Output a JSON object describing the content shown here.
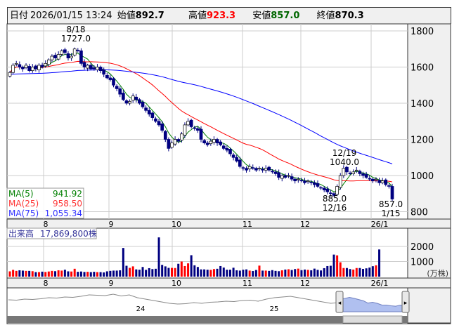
{
  "header": {
    "date_label": "日付",
    "datetime": "2026/01/15 13:24",
    "open_label": "始値",
    "open": "892.7",
    "high_label": "高値",
    "high": "923.3",
    "low_label": "安値",
    "low": "857.0",
    "close_label": "終値",
    "close": "870.3"
  },
  "colors": {
    "up": "#ff0000",
    "down": "#000080",
    "ma5": "#008000",
    "ma25": "#ff0000",
    "ma75": "#0000ff",
    "high": "#ff0000",
    "low": "#006600"
  },
  "legend": {
    "ma5_label": "MA(5)",
    "ma5": "941.92",
    "ma25_label": "MA(25)",
    "ma25": "958.50",
    "ma75_label": "MA(75)",
    "ma75": "1,055.34"
  },
  "volume_legend": {
    "label": "出来高",
    "value": "17,869,800株"
  },
  "annotations": {
    "high_date": "8/18",
    "high_value": "1727.0",
    "low_date": "12/16",
    "low_value": "885.0",
    "mid_date": "12/19",
    "mid_value": "1040.0",
    "last_value": "857.0",
    "last_date": "1/15"
  },
  "navigator": {
    "labels": [
      "24",
      "25"
    ],
    "series": [
      1530,
      1525,
      1540,
      1535,
      1545,
      1560,
      1555,
      1570,
      1565,
      1580,
      1600,
      1595,
      1590,
      1610,
      1585,
      1600,
      1560,
      1540,
      1520,
      1500,
      1480,
      1470,
      1475,
      1490,
      1480,
      1495,
      1500,
      1510,
      1505,
      1520,
      1525,
      1510,
      1540,
      1560,
      1570,
      1580,
      1560,
      1540,
      1520,
      1500,
      1480,
      1490
    ]
  },
  "chart_data": {
    "type": "candlestick",
    "y_ticks": [
      1800,
      1600,
      1400,
      1200,
      1000,
      800
    ],
    "ylim": [
      760,
      1840
    ],
    "x_month_labels": [
      "8",
      "9",
      "10",
      "11",
      "12",
      "26/1"
    ],
    "volume_unit": "(万株)",
    "volume_ticks": [
      2000,
      1000
    ],
    "closes": [
      1570,
      1610,
      1620,
      1600,
      1590,
      1610,
      1580,
      1600,
      1590,
      1610,
      1600,
      1620,
      1640,
      1660,
      1650,
      1670,
      1690,
      1680,
      1650,
      1660,
      1700,
      1690,
      1620,
      1600,
      1610,
      1590,
      1590,
      1600,
      1580,
      1560,
      1540,
      1530,
      1500,
      1480,
      1450,
      1420,
      1400,
      1410,
      1440,
      1420,
      1400,
      1380,
      1360,
      1340,
      1320,
      1300,
      1280,
      1250,
      1200,
      1150,
      1180,
      1200,
      1190,
      1230,
      1280,
      1300,
      1270,
      1260,
      1250,
      1200,
      1180,
      1170,
      1190,
      1200,
      1180,
      1170,
      1150,
      1140,
      1120,
      1100,
      1080,
      1050,
      1040,
      1030,
      1050,
      1040,
      1030,
      1040,
      1030,
      1040,
      1030,
      1020,
      1010,
      990,
      1000,
      990,
      1000,
      980,
      970,
      980,
      970,
      960,
      970,
      960,
      950,
      940,
      930,
      920,
      910,
      900,
      890,
      940,
      1000,
      1040,
      1020,
      1010,
      1020,
      1030,
      1010,
      1000,
      990,
      980,
      970,
      980,
      960,
      970,
      950,
      940,
      870
    ],
    "volumes": [
      350,
      450,
      380,
      420,
      400,
      380,
      380,
      360,
      300,
      300,
      330,
      310,
      340,
      380,
      360,
      420,
      400,
      460,
      350,
      340,
      520,
      320,
      340,
      310,
      320,
      300,
      320,
      300,
      300,
      280,
      350,
      380,
      400,
      400,
      420,
      1900,
      720,
      580,
      680,
      480,
      460,
      640,
      450,
      560,
      500,
      520,
      2600,
      780,
      680,
      580,
      580,
      570,
      850,
      1000,
      700,
      880,
      1420,
      750,
      640,
      480,
      480,
      460,
      450,
      500,
      520,
      700,
      600,
      460,
      460,
      590,
      420,
      400,
      460,
      480,
      400,
      370,
      440,
      730,
      400,
      400,
      380,
      430,
      380,
      360,
      420,
      470,
      490,
      440,
      500,
      530,
      430,
      470,
      450,
      420,
      530,
      450,
      410,
      560,
      700,
      720,
      1460,
      1410,
      950,
      570,
      570,
      500,
      470,
      570,
      570,
      510,
      550,
      600,
      690,
      750,
      1800
    ]
  }
}
